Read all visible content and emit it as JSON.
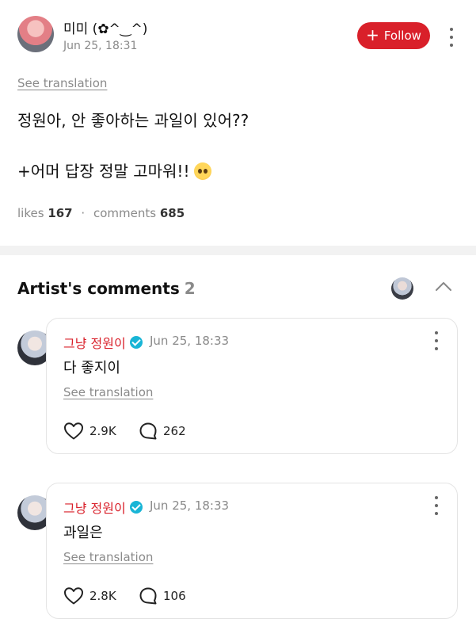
{
  "post": {
    "author": "미미 (✿^‿^)",
    "time": "Jun 25, 18:31",
    "follow_label": "Follow",
    "see_translation": "See translation",
    "body_line1": "정원아, 안 좋아하는 과일이 있어??",
    "body_line2": "+어머 답장 정말 고마워!!",
    "likes_label": "likes",
    "likes_count": "167",
    "comments_label": "comments",
    "comments_count": "685"
  },
  "artist_comments": {
    "title": "Artist's comments",
    "count": "2",
    "items": [
      {
        "name": "그냥 정원이",
        "time": "Jun 25, 18:33",
        "text": "다 좋지이",
        "see_translation": "See translation",
        "likes": "2.9K",
        "replies": "262"
      },
      {
        "name": "그냥 정원이",
        "time": "Jun 25, 18:33",
        "text": "과일은",
        "see_translation": "See translation",
        "likes": "2.8K",
        "replies": "106"
      }
    ]
  },
  "icons": {
    "follow": "plus-icon",
    "more": "more-vertical-icon",
    "collapse": "chevron-up-icon",
    "verified": "verified-badge-icon",
    "like": "heart-icon",
    "reply": "comment-bubble-icon",
    "emoji": "pleading-face-emoji"
  },
  "colors": {
    "accent": "#d9202a",
    "verified": "#19b5d6",
    "muted": "#8a8a8a"
  }
}
